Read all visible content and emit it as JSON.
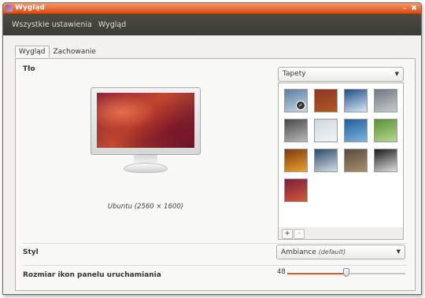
{
  "window": {
    "title": "Wygląd",
    "controls": {
      "minimize": "–",
      "close": "✖"
    }
  },
  "menubar": {
    "items": [
      {
        "label": "Wszystkie ustawienia"
      },
      {
        "label": "Wygląd"
      }
    ]
  },
  "tabs": [
    {
      "label": "Wygląd",
      "active": true
    },
    {
      "label": "Zachowanie",
      "active": false
    }
  ],
  "background": {
    "section_label": "Tło",
    "source_dropdown": {
      "value": "Tapety"
    },
    "preview_caption": "Ubuntu (2560 × 1600)",
    "wallpapers": [
      {
        "name": "wallpaper-1",
        "colors": [
          "#5a7fa8",
          "#c9d6e2"
        ],
        "selected": true
      },
      {
        "name": "wallpaper-2",
        "colors": [
          "#8a3a1c",
          "#b4552a"
        ],
        "selected": false
      },
      {
        "name": "wallpaper-3",
        "colors": [
          "#1e4f8c",
          "#dbe6f0"
        ],
        "selected": false
      },
      {
        "name": "wallpaper-4",
        "colors": [
          "#6e7780",
          "#c8ccd0"
        ],
        "selected": false
      },
      {
        "name": "wallpaper-5",
        "colors": [
          "#4a4a4a",
          "#b9b9b9"
        ],
        "selected": false
      },
      {
        "name": "wallpaper-6",
        "colors": [
          "#cfd7de",
          "#f2f4f6"
        ],
        "selected": false
      },
      {
        "name": "wallpaper-7",
        "colors": [
          "#1f5f9a",
          "#7fb4dc"
        ],
        "selected": false
      },
      {
        "name": "wallpaper-8",
        "colors": [
          "#5a8f3a",
          "#b6d98e"
        ],
        "selected": false
      },
      {
        "name": "wallpaper-9",
        "colors": [
          "#7a3b0d",
          "#f0a030"
        ],
        "selected": false
      },
      {
        "name": "wallpaper-10",
        "colors": [
          "#2a4a6a",
          "#d6dde6"
        ],
        "selected": false
      },
      {
        "name": "wallpaper-11",
        "colors": [
          "#5c4a3a",
          "#a89070"
        ],
        "selected": false
      },
      {
        "name": "wallpaper-12",
        "colors": [
          "#1a1a1a",
          "#e0e0e0"
        ],
        "selected": false
      },
      {
        "name": "wallpaper-13",
        "colors": [
          "#7a1f3a",
          "#d25a3a"
        ],
        "selected": false
      }
    ],
    "add_button": "+",
    "remove_button": "–"
  },
  "style": {
    "label": "Styl",
    "dropdown": {
      "value": "Ambiance",
      "suffix": "(default)"
    }
  },
  "launcher_icon_size": {
    "label": "Rozmiar ikon panelu uruchamiania",
    "value": "48",
    "fraction": 0.5
  },
  "colors": {
    "titlebar": "#dd4814",
    "menubar": "#3c3b37",
    "slider_fill": "#e05a2a",
    "slider_track": "#c8c4be"
  }
}
